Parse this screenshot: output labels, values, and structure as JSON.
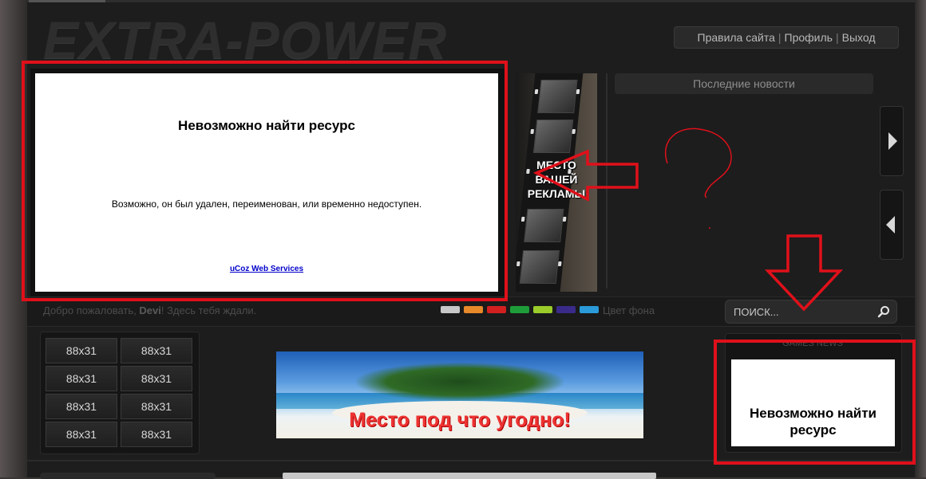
{
  "logo": "EXTRA-POWER",
  "topnav": {
    "items": [
      "Правила сайта",
      "Профиль",
      "Выход"
    ],
    "separator": "|"
  },
  "slider": {
    "error_title": "Невозможно найти ресурс",
    "error_text": "Возможно, он был удален, переименован, или временно недоступен.",
    "error_link": "uCoz Web Services"
  },
  "ad": {
    "lines": [
      "МЕСТО",
      "ВАШЕЙ",
      "РЕКЛАМЫ"
    ]
  },
  "news": {
    "header": "Последние новости"
  },
  "welcome": {
    "prefix": "Добро пожаловать, ",
    "user": "Devi",
    "suffix": "! Здесь тебя ждали."
  },
  "theme": {
    "label": "Цвет фона",
    "swatches": [
      "#c8c8c8",
      "#e8892a",
      "#d21f1f",
      "#1f9c3a",
      "#9bcc2a",
      "#3a2a8a",
      "#2a9ad8"
    ]
  },
  "search": {
    "placeholder": "ПОИСК..."
  },
  "buttons": [
    "88x31",
    "88x31",
    "88x31",
    "88x31",
    "88x31",
    "88x31",
    "88x31",
    "88x31"
  ],
  "banner": {
    "text": "Место под что угодно!"
  },
  "games_news": {
    "title": "GAMES NEWS",
    "error_title": "Невозможно найти ресурс"
  },
  "annotation": {
    "question": "?",
    "color": "#e0101a"
  }
}
